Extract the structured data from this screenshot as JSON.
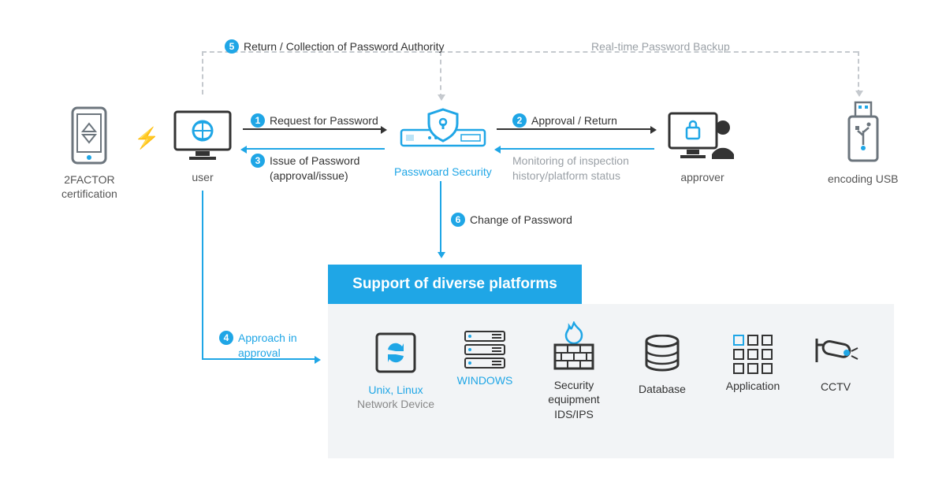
{
  "nodes": {
    "twofactor": {
      "label_line1": "2FACTOR",
      "label_line2": "certification"
    },
    "user": {
      "label": "user"
    },
    "ps": {
      "label": "Passwoard Security"
    },
    "approver": {
      "label": "approver"
    },
    "usb": {
      "label": "encoding USB"
    }
  },
  "steps": {
    "s1": {
      "num": "1",
      "text": "Request for Password"
    },
    "s2": {
      "num": "2",
      "text": "Approval / Return"
    },
    "s3": {
      "num": "3",
      "line1": "Issue of Password",
      "line2": "(approval/issue)"
    },
    "monitor": {
      "line1": "Monitoring of inspection",
      "line2": "history/platform status"
    },
    "s4": {
      "num": "4",
      "line1": "Approach in",
      "line2": "approval"
    },
    "s5": {
      "num": "5",
      "text": "Return / Collection of Password Authority"
    },
    "backup": {
      "text": "Real-time Password Backup"
    },
    "s6": {
      "num": "6",
      "text": "Change of Password"
    }
  },
  "banner": "Support of diverse platforms",
  "platforms": {
    "unix": {
      "line1": "Unix, Linux",
      "line2": "Network Device"
    },
    "win": {
      "line1": "WINDOWS"
    },
    "sec": {
      "line1": "Security",
      "line2": "equipment",
      "line3": "IDS/IPS"
    },
    "db": {
      "line1": "Database"
    },
    "app": {
      "line1": "Application"
    },
    "cctv": {
      "line1": "CCTV"
    }
  }
}
